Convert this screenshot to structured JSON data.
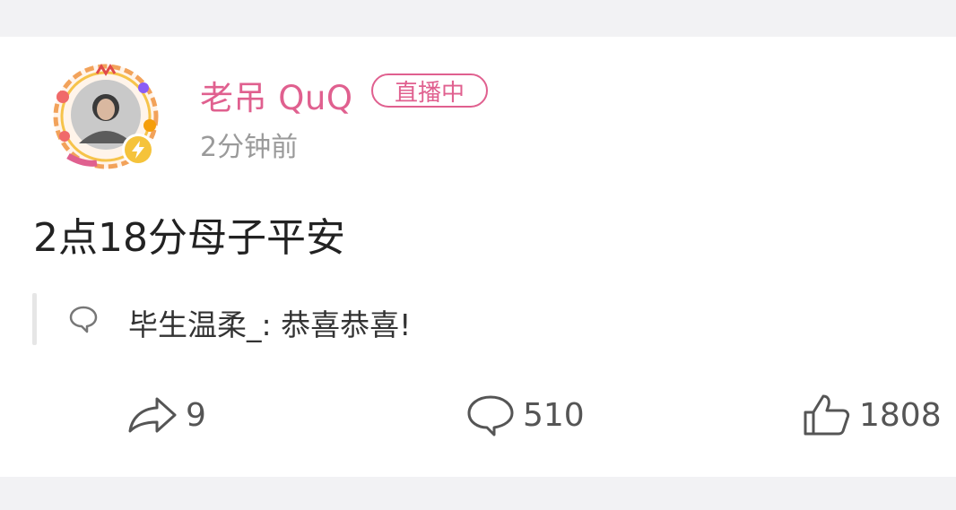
{
  "post": {
    "username": "老吊 QuQ",
    "live_badge": "直播中",
    "timestamp": "2分钟前",
    "body": "2点18分母子平安",
    "comment_preview": {
      "author": "毕生温柔_",
      "text": ": 恭喜恭喜!"
    },
    "actions": {
      "share_count": "9",
      "comment_count": "510",
      "like_count": "1808"
    }
  },
  "icons": {
    "share": "share-arrow-icon",
    "comment": "comment-bubble-icon",
    "like": "thumbs-up-icon",
    "verified": "lightning-badge-icon"
  },
  "colors": {
    "accent": "#e0608f",
    "verified": "#f5c33b",
    "background": "#f2f2f4",
    "card": "#ffffff",
    "muted": "#9a9a9a"
  }
}
